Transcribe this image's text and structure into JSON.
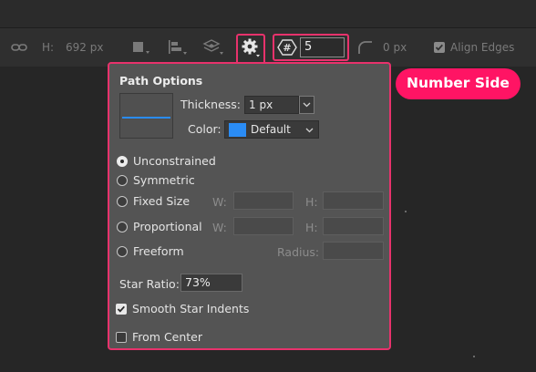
{
  "toolbar": {
    "h_label": "H:",
    "h_value": "692 px",
    "sides_value": "5",
    "radius_value": "0 px",
    "align_edges_label": "Align Edges",
    "align_edges_checked": true,
    "icons": [
      "link-icon",
      "path-operations-icon",
      "path-alignment-icon",
      "path-arrangement-icon",
      "gear-icon",
      "number-sides-icon",
      "corner-radius-icon"
    ]
  },
  "path_options": {
    "title": "Path Options",
    "thickness_label": "Thickness:",
    "thickness_value": "1 px",
    "color_label": "Color:",
    "color_value": "Default",
    "color_swatch": "#2a8cf5",
    "options": [
      {
        "label": "Unconstrained",
        "selected": true
      },
      {
        "label": "Symmetric",
        "selected": false
      },
      {
        "label": "Fixed Size",
        "selected": false
      },
      {
        "label": "Proportional",
        "selected": false
      },
      {
        "label": "Freeform",
        "selected": false
      }
    ],
    "w_label": "W:",
    "h_label": "H:",
    "radius_label": "Radius:",
    "star_ratio_label": "Star Ratio:",
    "star_ratio_value": "73%",
    "smooth_indents_label": "Smooth Star Indents",
    "smooth_indents_checked": true,
    "from_center_label": "From Center",
    "from_center_checked": false
  },
  "callout": {
    "label": "Number Side",
    "color": "#ff1464"
  },
  "highlight_color": "#e8326c"
}
